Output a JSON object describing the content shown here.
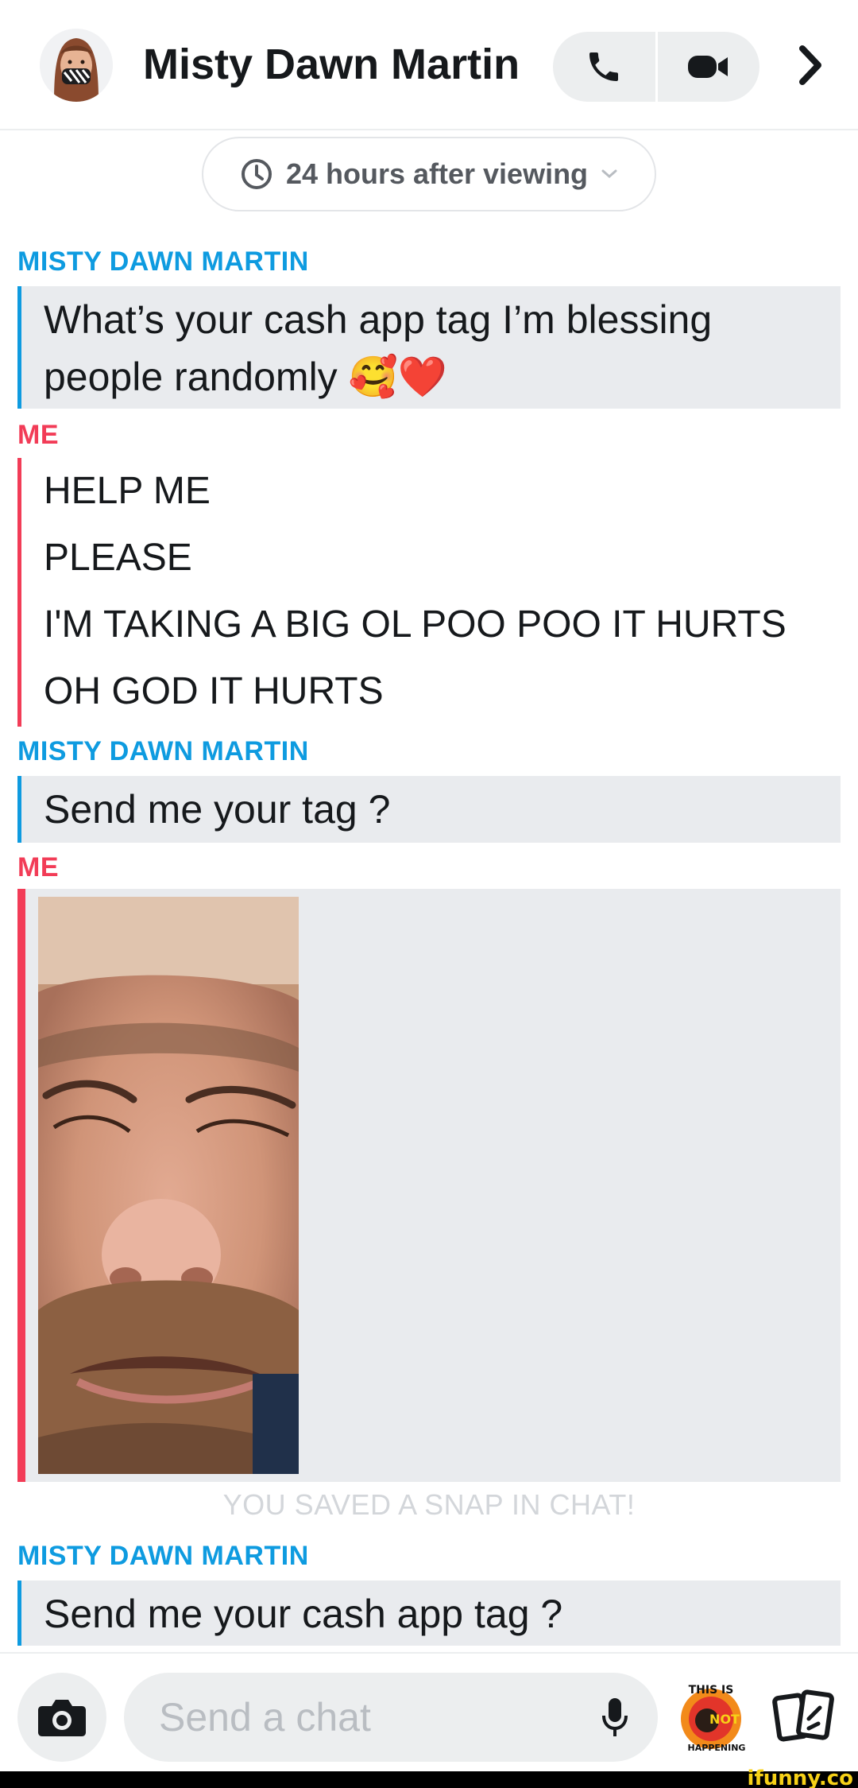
{
  "header": {
    "title": "Misty Dawn Martin",
    "avatar_icon": "bitmoji-avatar-icon",
    "call_icon": "phone-icon",
    "video_icon": "video-camera-icon",
    "next_icon": "chevron-right-icon"
  },
  "retention": {
    "label": "24 hours after viewing",
    "icon": "clock-icon",
    "dropdown_icon": "chevron-down-icon"
  },
  "messages": [
    {
      "sender": "MISTY DAWN MARTIN",
      "text": "What’s your cash app tag I’m blessing",
      "text_line2": "people randomly 🥰❤️"
    },
    {
      "sender": "ME",
      "lines": [
        "HELP ME",
        "PLEASE",
        "I'M TAKING A BIG OL POO POO IT HURTS",
        "OH GOD IT HURTS"
      ]
    },
    {
      "sender": "MISTY DAWN MARTIN",
      "text": "Send me your tag ?"
    },
    {
      "sender": "ME",
      "snap": "photo of a crying bearded man"
    },
    {
      "sender": "MISTY DAWN MARTIN",
      "text": "Send me your cash app tag ?"
    }
  ],
  "saved_note": "YOU SAVED A SNAP IN CHAT!",
  "composer": {
    "placeholder": "Send a chat",
    "camera_icon": "camera-icon",
    "mic_icon": "microphone-icon",
    "sticker_text_1": "THIS IS",
    "sticker_text_2": "NOT",
    "sticker_text_3": "HAPPENING",
    "cards_icon": "cards-icon"
  },
  "watermark": "ifunny.co",
  "colors": {
    "friend": "#0e9be0",
    "me": "#f23c57",
    "bubble_bg": "#e9ebee"
  }
}
